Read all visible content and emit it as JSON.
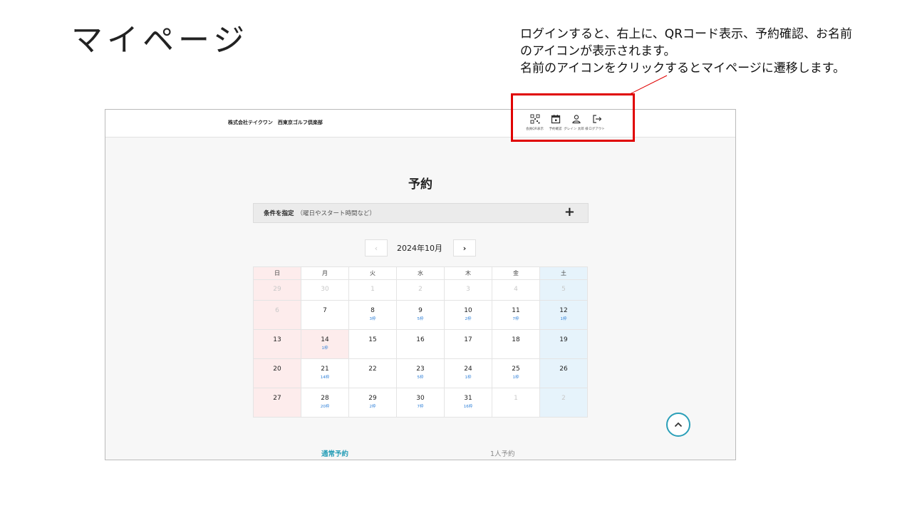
{
  "slide": {
    "title": "マイページ",
    "note": [
      "ログインすると、右上に、QRコード表示、予約確認、お名前",
      "のアイコンが表示されます。",
      "名前のアイコンをクリックするとマイページに遷移します。"
    ],
    "highlight_color": "#e00000"
  },
  "header": {
    "company": "株式会社テイクワン　西東京ゴルフ倶楽部",
    "icons": [
      {
        "icon": "qr-code-icon",
        "label": "会員QR表示"
      },
      {
        "icon": "calendar-icon",
        "label": "予約確認"
      },
      {
        "icon": "person-icon",
        "label": "グレイン 太郎 様"
      },
      {
        "icon": "logout-icon",
        "label": "ログアウト"
      }
    ]
  },
  "main": {
    "title": "予約",
    "filter": {
      "label": "条件を指定",
      "sub": "（曜日やスタート時間など）",
      "toggle": "+"
    },
    "month": "2024年10月",
    "prev": "‹",
    "next": "›"
  },
  "calendar": {
    "weekdays": [
      "日",
      "月",
      "火",
      "水",
      "木",
      "金",
      "土"
    ],
    "weeks": [
      [
        {
          "d": "29",
          "off": true
        },
        {
          "d": "30",
          "off": true
        },
        {
          "d": "1",
          "off": true
        },
        {
          "d": "2",
          "off": true
        },
        {
          "d": "3",
          "off": true
        },
        {
          "d": "4",
          "off": true
        },
        {
          "d": "5",
          "off": true
        }
      ],
      [
        {
          "d": "6",
          "off": true
        },
        {
          "d": "7"
        },
        {
          "d": "8",
          "s": "3枠"
        },
        {
          "d": "9",
          "s": "5枠"
        },
        {
          "d": "10",
          "s": "2枠"
        },
        {
          "d": "11",
          "s": "7枠"
        },
        {
          "d": "12",
          "s": "1枠"
        }
      ],
      [
        {
          "d": "13"
        },
        {
          "d": "14",
          "s": "1枠",
          "hl": true
        },
        {
          "d": "15"
        },
        {
          "d": "16"
        },
        {
          "d": "17"
        },
        {
          "d": "18"
        },
        {
          "d": "19"
        }
      ],
      [
        {
          "d": "20"
        },
        {
          "d": "21",
          "s": "14枠"
        },
        {
          "d": "22"
        },
        {
          "d": "23",
          "s": "5枠"
        },
        {
          "d": "24",
          "s": "1枠"
        },
        {
          "d": "25",
          "s": "1枠"
        },
        {
          "d": "26"
        }
      ],
      [
        {
          "d": "27"
        },
        {
          "d": "28",
          "s": "20枠"
        },
        {
          "d": "29",
          "s": "2枠"
        },
        {
          "d": "30",
          "s": "7枠"
        },
        {
          "d": "31",
          "s": "16枠"
        },
        {
          "d": "1",
          "off": true
        },
        {
          "d": "2",
          "off": true
        }
      ]
    ]
  },
  "tabs": [
    "通常予約",
    "1人予約"
  ],
  "colors": {
    "accent": "#2a9fb8",
    "slot": "#2d7fd8",
    "sunday_bg": "#fdecec",
    "saturday_bg": "#e6f3fb"
  }
}
